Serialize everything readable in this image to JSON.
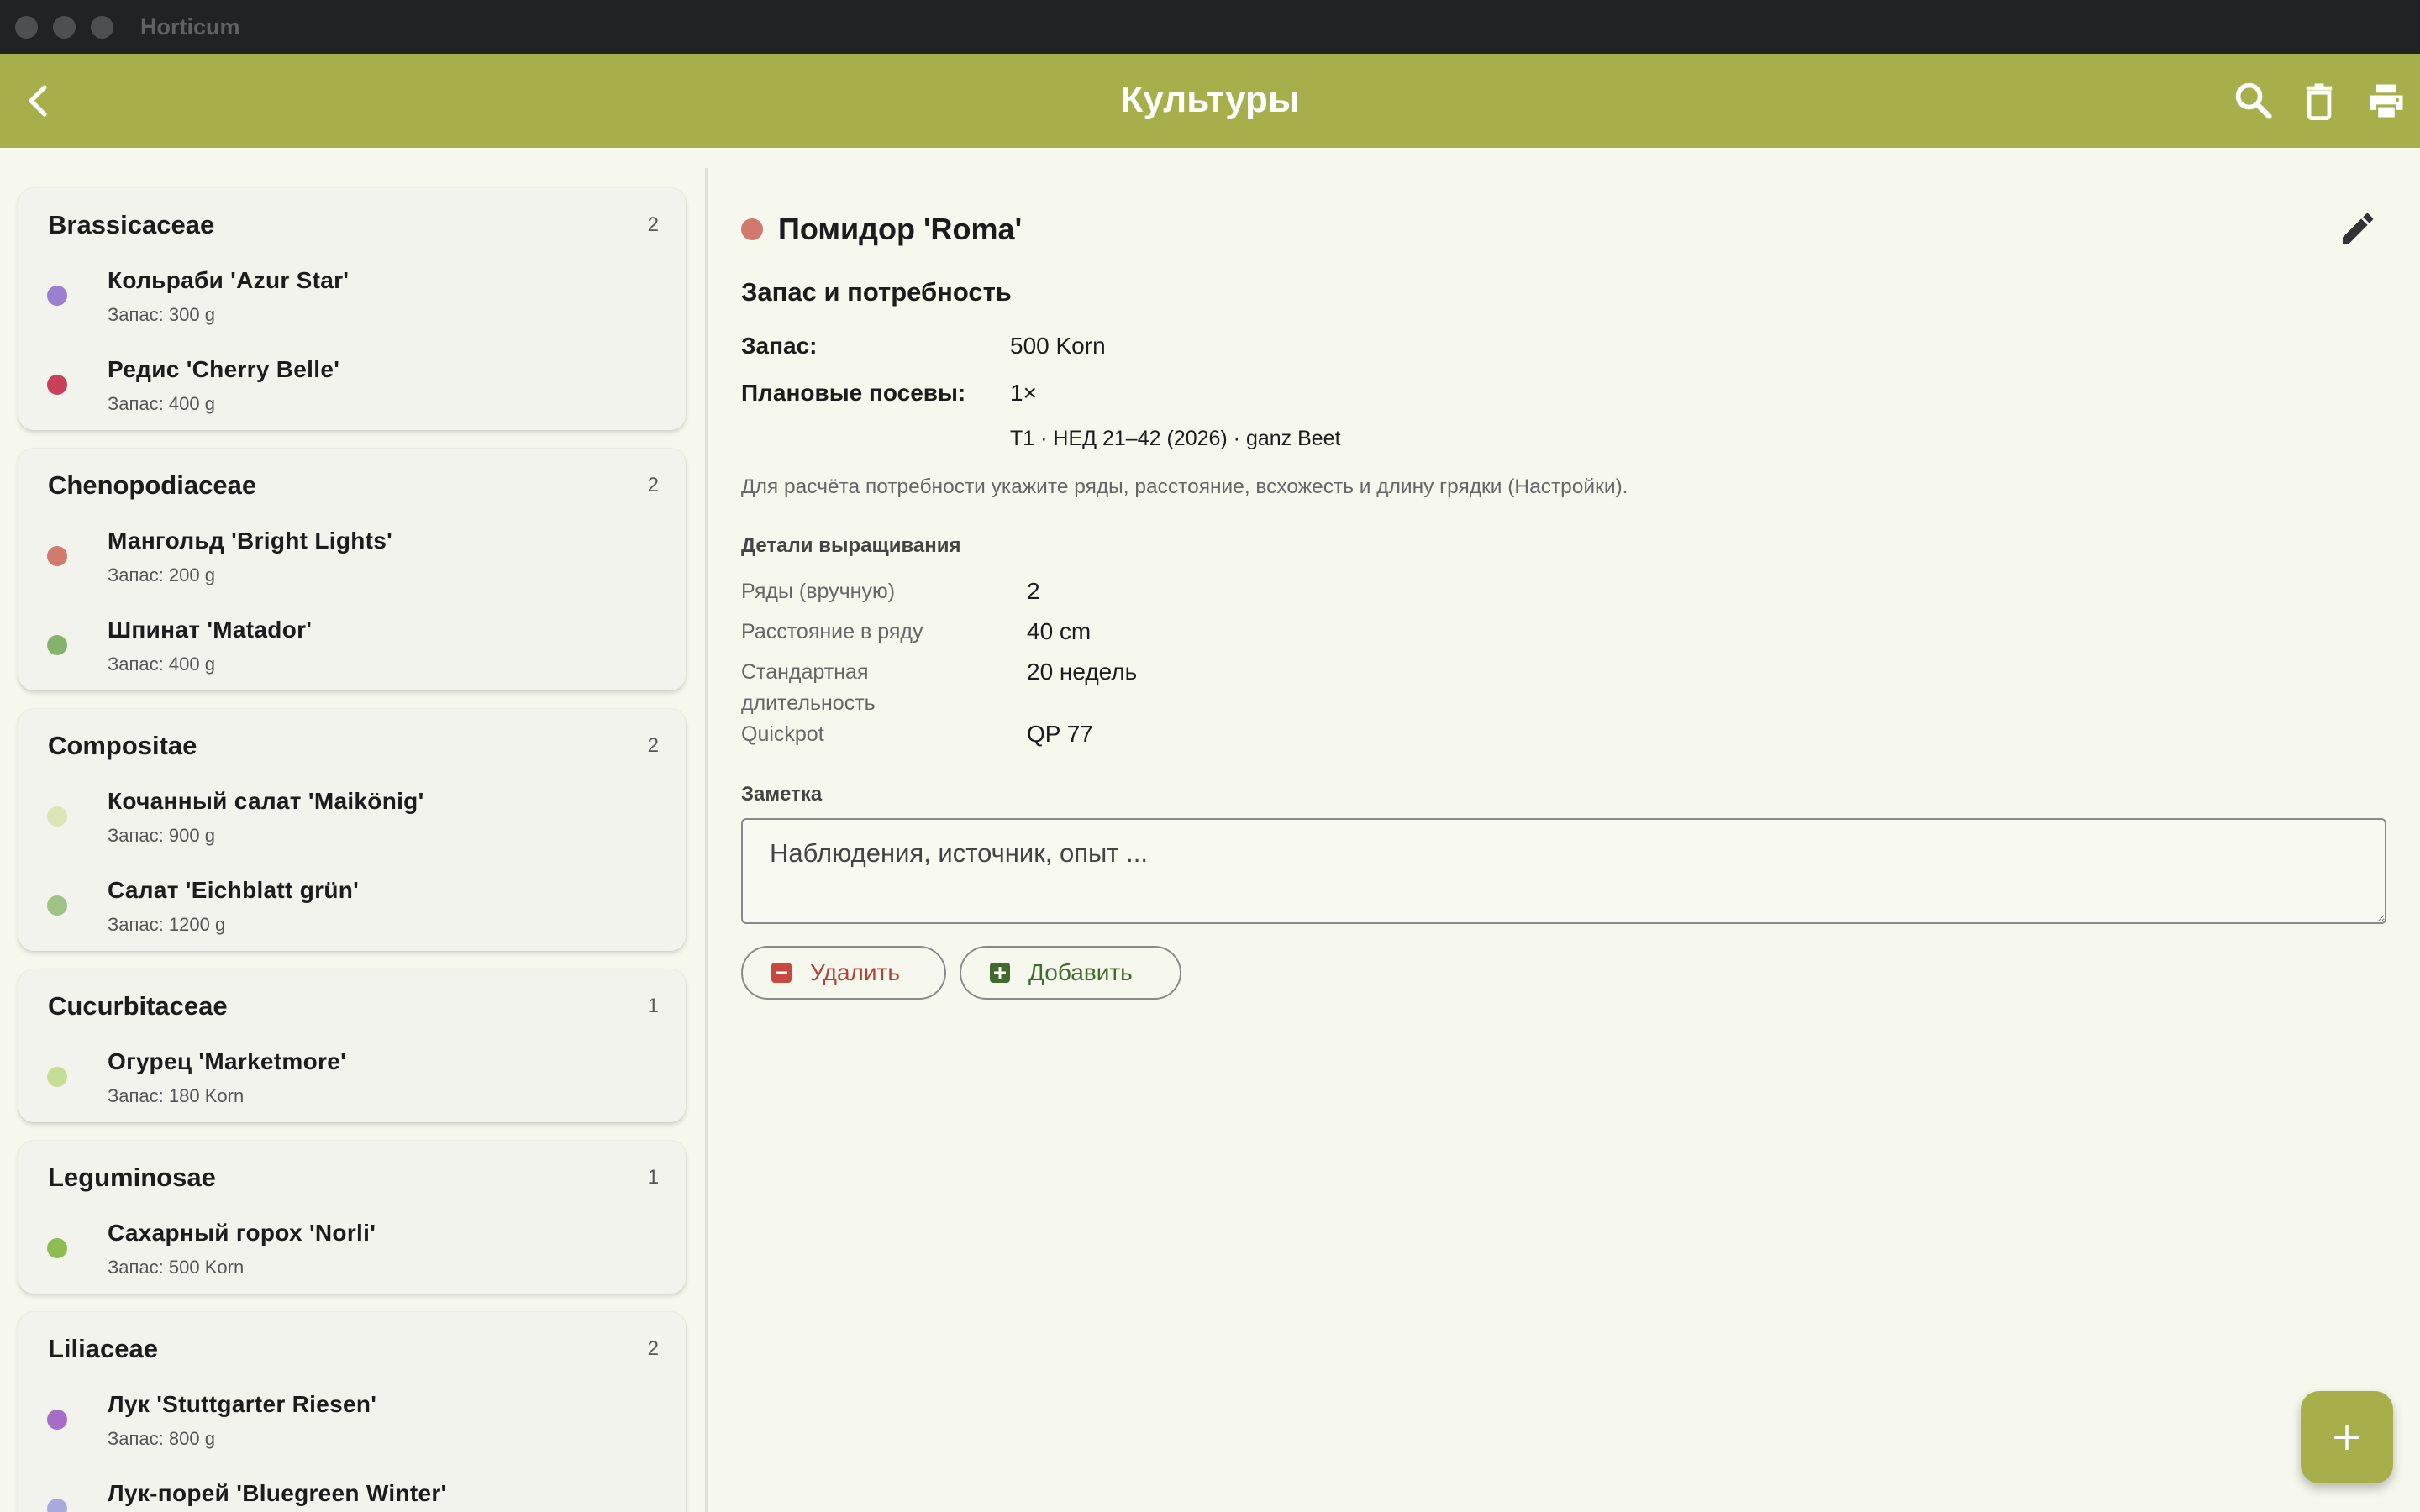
{
  "window": {
    "title": "Horticum"
  },
  "appbar": {
    "title": "Культуры",
    "icons": [
      "back-arrow-icon",
      "search-icon",
      "trash-icon",
      "print-icon"
    ]
  },
  "sidebar": {
    "groups": [
      {
        "name": "Brassicaceae",
        "count": "2",
        "items": [
          {
            "name": "Кольраби 'Azur Star'",
            "stock": "Запас: 300 g",
            "color": "#9b7fd0"
          },
          {
            "name": "Редис 'Cherry Belle'",
            "stock": "Запас: 400 g",
            "color": "#c8405a"
          }
        ]
      },
      {
        "name": "Chenopodiaceae",
        "count": "2",
        "items": [
          {
            "name": "Мангольд 'Bright Lights'",
            "stock": "Запас: 200 g",
            "color": "#d17a6e"
          },
          {
            "name": "Шпинат 'Matador'",
            "stock": "Запас: 400 g",
            "color": "#86b36b"
          }
        ]
      },
      {
        "name": "Compositae",
        "count": "2",
        "items": [
          {
            "name": "Кочанный салат 'Maikönig'",
            "stock": "Запас: 900 g",
            "color": "#d9e6b5"
          },
          {
            "name": "Салат 'Eichblatt grün'",
            "stock": "Запас: 1200 g",
            "color": "#9fc385"
          }
        ]
      },
      {
        "name": "Cucurbitaceae",
        "count": "1",
        "items": [
          {
            "name": "Огурец 'Marketmore'",
            "stock": "Запас: 180 Korn",
            "color": "#c6dd96"
          }
        ]
      },
      {
        "name": "Leguminosae",
        "count": "1",
        "items": [
          {
            "name": "Сахарный горох 'Norli'",
            "stock": "Запас: 500 Korn",
            "color": "#8ebd52"
          }
        ]
      },
      {
        "name": "Liliaceae",
        "count": "2",
        "items": [
          {
            "name": "Лук 'Stuttgarter Riesen'",
            "stock": "Запас: 800 g",
            "color": "#a56cc8"
          },
          {
            "name": "Лук-порей 'Bluegreen Winter'",
            "stock": "",
            "color": "#a9a9dd"
          }
        ]
      }
    ]
  },
  "detail": {
    "crop_name": "Помидор 'Roma'",
    "crop_color": "#d1786f",
    "section_title": "Запас и потребность",
    "stock_label": "Запас:",
    "stock_value": "500 Korn",
    "planned_label": "Плановые посевы:",
    "planned_value": "1×",
    "plan_line": "T1 · НЕД 21–42 (2026) · ganz Beet",
    "hint": "Для расчёта потребности укажите ряды, расстояние, всхожесть и длину грядки (Настройки).",
    "growing_title": "Детали выращивания",
    "rows_label": "Ряды (вручную)",
    "rows_value": "2",
    "spacing_label": "Расстояние в ряду",
    "spacing_value": "40 cm",
    "duration_label": "Стандартная длительность",
    "duration_value": "20 недель",
    "quickpot_label": "Quickpot",
    "quickpot_value": "QP 77",
    "note_label": "Заметка",
    "note_placeholder": "Наблюдения, источник, опыт ...",
    "delete_label": "Удалить",
    "add_label": "Добавить",
    "delete_color": "#b5413a",
    "add_color": "#3f6b2c"
  }
}
